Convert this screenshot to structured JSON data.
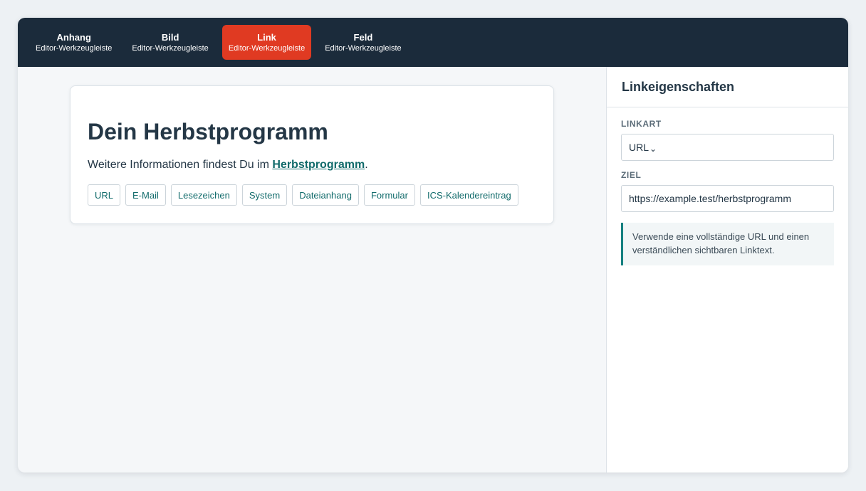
{
  "toolbar": {
    "tabs": [
      {
        "label": "Anhang",
        "sublabel": "Editor-Werkzeugleiste"
      },
      {
        "label": "Bild",
        "sublabel": "Editor-Werkzeugleiste"
      },
      {
        "label": "Link",
        "sublabel": "Editor-Werkzeugleiste",
        "active": true
      },
      {
        "label": "Feld",
        "sublabel": "Editor-Werkzeugleiste"
      }
    ]
  },
  "card": {
    "title": "Dein Herbstprogramm",
    "text_before": "Weitere Informationen findest Du im ",
    "link_text": "Herbstprogramm",
    "text_after": ".",
    "chips": [
      "URL",
      "E-Mail",
      "Lesezeichen",
      "System",
      "Dateianhang",
      "Formular",
      "ICS-Kalendereintrag"
    ]
  },
  "panel": {
    "title": "Linkeigenschaften",
    "linkart_label": "LINKART",
    "linkart_value": "URL",
    "linkart_chevron": "⌄",
    "ziel_label": "ZIEL",
    "ziel_value": "https://example.test/herbstprogramm",
    "hint": "Verwende eine vollständige URL und einen verständlichen sichtbaren Linktext."
  },
  "colors": {
    "toolbar_bg": "#1b2b3b",
    "active_tab": "#e03a22",
    "link_accent": "#116b6b"
  }
}
